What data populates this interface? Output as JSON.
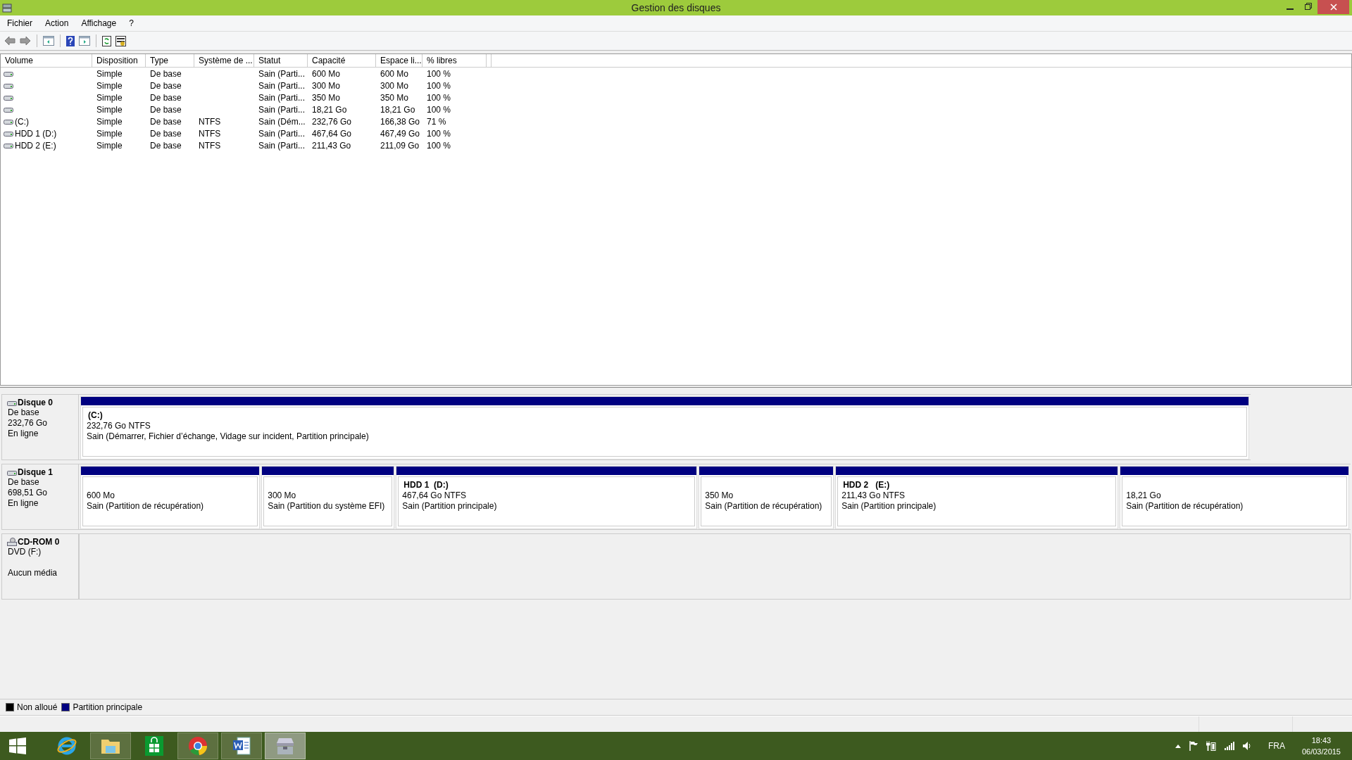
{
  "window": {
    "title": "Gestion des disques"
  },
  "menu": [
    "Fichier",
    "Action",
    "Affichage",
    "?"
  ],
  "table": {
    "columns": [
      "Volume",
      "Disposition",
      "Type",
      "Système de ...",
      "Statut",
      "Capacité",
      "Espace li...",
      "% libres"
    ],
    "rows": [
      [
        "",
        "Simple",
        "De base",
        "",
        "Sain (Parti...",
        "600 Mo",
        "600 Mo",
        "100 %"
      ],
      [
        "",
        "Simple",
        "De base",
        "",
        "Sain (Parti...",
        "300 Mo",
        "300 Mo",
        "100 %"
      ],
      [
        "",
        "Simple",
        "De base",
        "",
        "Sain (Parti...",
        "350 Mo",
        "350 Mo",
        "100 %"
      ],
      [
        "",
        "Simple",
        "De base",
        "",
        "Sain (Parti...",
        "18,21 Go",
        "18,21 Go",
        "100 %"
      ],
      [
        "(C:)",
        "Simple",
        "De base",
        "NTFS",
        "Sain (Dém...",
        "232,76 Go",
        "166,38 Go",
        "71 %"
      ],
      [
        "HDD 1 (D:)",
        "Simple",
        "De base",
        "NTFS",
        "Sain (Parti...",
        "467,64 Go",
        "467,49 Go",
        "100 %"
      ],
      [
        "HDD 2  (E:)",
        "Simple",
        "De base",
        "NTFS",
        "Sain (Parti...",
        "211,43 Go",
        "211,09 Go",
        "100 %"
      ]
    ]
  },
  "disks": [
    {
      "kind": "disk",
      "name": "Disque 0",
      "lines": [
        "De base",
        "232,76 Go",
        "En ligne"
      ],
      "partitions": [
        {
          "name": "(C:)",
          "size": "232,76 Go NTFS",
          "status": "Sain (Démarrer, Fichier d’échange, Vidage sur incident, Partition principale)"
        }
      ]
    },
    {
      "kind": "disk",
      "name": "Disque 1",
      "lines": [
        "De base",
        "698,51 Go",
        "En ligne"
      ],
      "partitions": [
        {
          "size": "600 Mo",
          "status": "Sain (Partition de récupération)"
        },
        {
          "size": "300 Mo",
          "status": "Sain (Partition du système EFI)"
        },
        {
          "name": "HDD 1  (D:)",
          "size": "467,64 Go NTFS",
          "status": "Sain (Partition principale)"
        },
        {
          "size": "350 Mo",
          "status": "Sain (Partition de récupération)"
        },
        {
          "name": "HDD 2   (E:)",
          "size": "211,43 Go NTFS",
          "status": "Sain (Partition principale)"
        },
        {
          "size": "18,21 Go",
          "status": "Sain (Partition de récupération)"
        }
      ]
    },
    {
      "kind": "cdrom",
      "name": "CD-ROM 0",
      "lines": [
        "DVD (F:)",
        "Aucun média"
      ]
    }
  ],
  "legend": [
    {
      "label": "Non alloué",
      "color": "#000000"
    },
    {
      "label": "Partition principale",
      "color": "#000080"
    }
  ],
  "taskbar": {
    "tray": {
      "language": "FRA",
      "time": "18:43",
      "date": "06/03/2015"
    }
  }
}
